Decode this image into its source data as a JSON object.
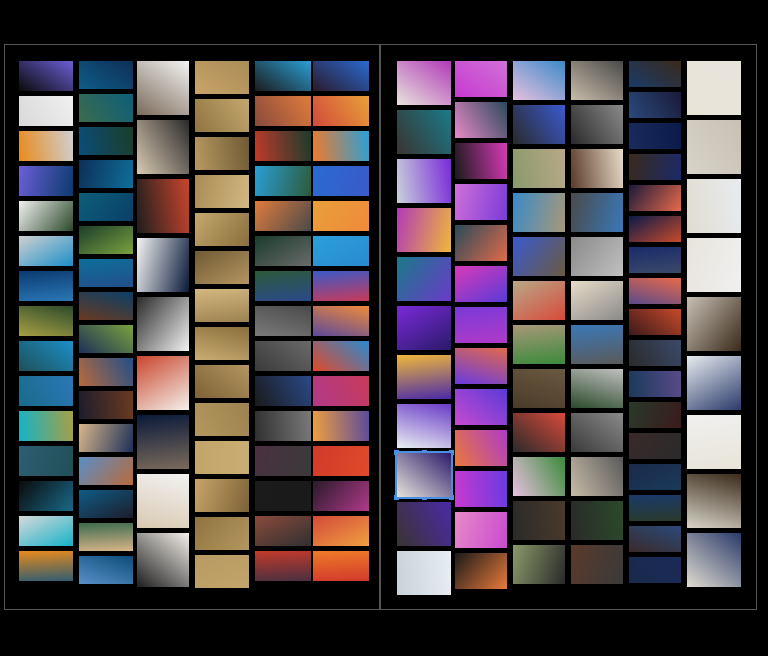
{
  "app": {
    "view": "spread-view",
    "pages": [
      "left",
      "right"
    ]
  },
  "colors": {
    "background": "#000000",
    "page_border": "#555555",
    "selection": "#4a90e2"
  },
  "left_page": {
    "columns": [
      {
        "name": "col-1",
        "palette": [
          "#0a0a0a",
          "#d9d9d9",
          "#e88a1c",
          "#6b5fd6",
          "#f0f0f0",
          "#d0d0d0",
          "#0b3a6e",
          "#2c4a2a",
          "#1b8fc9",
          "#2a78b8",
          "#a6a044",
          "#1f5058",
          "#1a6a8a",
          "#14b3c8",
          "#2f5d72"
        ],
        "count": 15
      },
      {
        "name": "col-2",
        "palette": [
          "#0f5c86",
          "#3c6b4d",
          "#0b4d78",
          "#0d2f57",
          "#0c5e7a",
          "#1b3d2b",
          "#0d6f9b",
          "#0a3f68",
          "#7aa23d",
          "#224f8a",
          "#6a3a20",
          "#1c3058",
          "#b86a3a",
          "#1d1d2b",
          "#d8b58a",
          "#5a8fc8"
        ],
        "count": 16
      },
      {
        "name": "col-3",
        "palette": [
          "#7b6a5a",
          "#d9c9b2",
          "#1e1e1e",
          "#f4f4f4",
          "#2b2b2b",
          "#c9452d",
          "#0a1a3a",
          "#f2f2f2",
          "#f4f0ea"
        ],
        "count": 9
      },
      {
        "name": "col-4",
        "palette": [
          "#c8a46a",
          "#8f7440",
          "#b89a62",
          "#a98c55",
          "#c4a86e",
          "#6f5a34",
          "#d4b881",
          "#8a6e3c",
          "#b59560",
          "#9c8250",
          "#c9ad72",
          "#7c6236",
          "#b4975e",
          "#c1a56a"
        ],
        "count": 14
      },
      {
        "name": "col-5",
        "palette": [
          "#1b1b1b",
          "#8a4a3c",
          "#c23a2a",
          "#2a9fd6",
          "#e07c3c",
          "#1a3b2c",
          "#2c5a3a",
          "#4a4a4a",
          "#6a6a6a",
          "#2a4a8a",
          "#7a7a7a",
          "#3a3a3a",
          "#1a1a1a",
          "#303030",
          "#4a3040"
        ],
        "count": 15
      },
      {
        "name": "col-6",
        "palette": [
          "#2a1a2a",
          "#d24a3a",
          "#f07a2a",
          "#2a6ad2",
          "#e8a03a",
          "#2aa0d8",
          "#3a5ac8",
          "#f08a3a",
          "#2a8ad0",
          "#c83a5a",
          "#5a4a9a",
          "#e04a2a",
          "#b03a8a",
          "#f0a040",
          "#d03a2a"
        ],
        "count": 15
      }
    ]
  },
  "right_page": {
    "columns": [
      {
        "name": "col-7",
        "palette": [
          "#e8e4dc",
          "#3a3430",
          "#c8d2da",
          "#b13ab8",
          "#1a7a8a",
          "#7a2ad8",
          "#f0b83a",
          "#6a3ac8",
          "#2a1a6a",
          "#4a2aa8",
          "#e8eef2"
        ],
        "count": 11,
        "selected_index": 8
      },
      {
        "name": "col-8",
        "palette": [
          "#c83ad0",
          "#e88ac8",
          "#1a1a1a",
          "#d070d8",
          "#2a4a5a",
          "#d83ab8",
          "#7a3ad8",
          "#e06a4a",
          "#5a3ad8",
          "#b03ac8",
          "#6a3ae0",
          "#c84ad0",
          "#e87a3a"
        ],
        "count": 13
      },
      {
        "name": "col-9",
        "palette": [
          "#e8c0e0",
          "#2a2a2a",
          "#8a9a6a",
          "#3a8ac8",
          "#3a5ad0",
          "#b8a888",
          "#a89878",
          "#6a5a40",
          "#d84a3a",
          "#3a8a3a",
          "#4a3a2a",
          "#2a2a2a"
        ],
        "count": 12
      },
      {
        "name": "col-10",
        "palette": [
          "#c8bca8",
          "#2a2a2a",
          "#5a3a2a",
          "#4a4a4a",
          "#8a8a8a",
          "#e8dcc8",
          "#3a78b8",
          "#c0c0c0",
          "#8a8a8a",
          "#5a5a5a",
          "#2a4a2a",
          "#3a3a3a"
        ],
        "count": 12
      },
      {
        "name": "col-11",
        "palette": [
          "#1a3a6a",
          "#2a4a7a",
          "#1a2a5a",
          "#3a2a1a",
          "#1a1a3a",
          "#0a1a4a",
          "#1a2a6a",
          "#e86a4a",
          "#c84a2a",
          "#3a4a6a",
          "#5a4a8a",
          "#3a1a1a",
          "#2a2a2a",
          "#1a3a5a",
          "#2a3a2a",
          "#3a2a2a",
          "#1a2a4a"
        ],
        "count": 17
      },
      {
        "name": "col-12",
        "palette": [
          "#e8e4d8",
          "#d8d4c8",
          "#e0dcd0",
          "#e8e4dc",
          "#c8c0b4",
          "#e8ecf0",
          "#f0f0f0",
          "#3a2a1a",
          "#2a3a6a"
        ],
        "count": 9
      }
    ]
  }
}
